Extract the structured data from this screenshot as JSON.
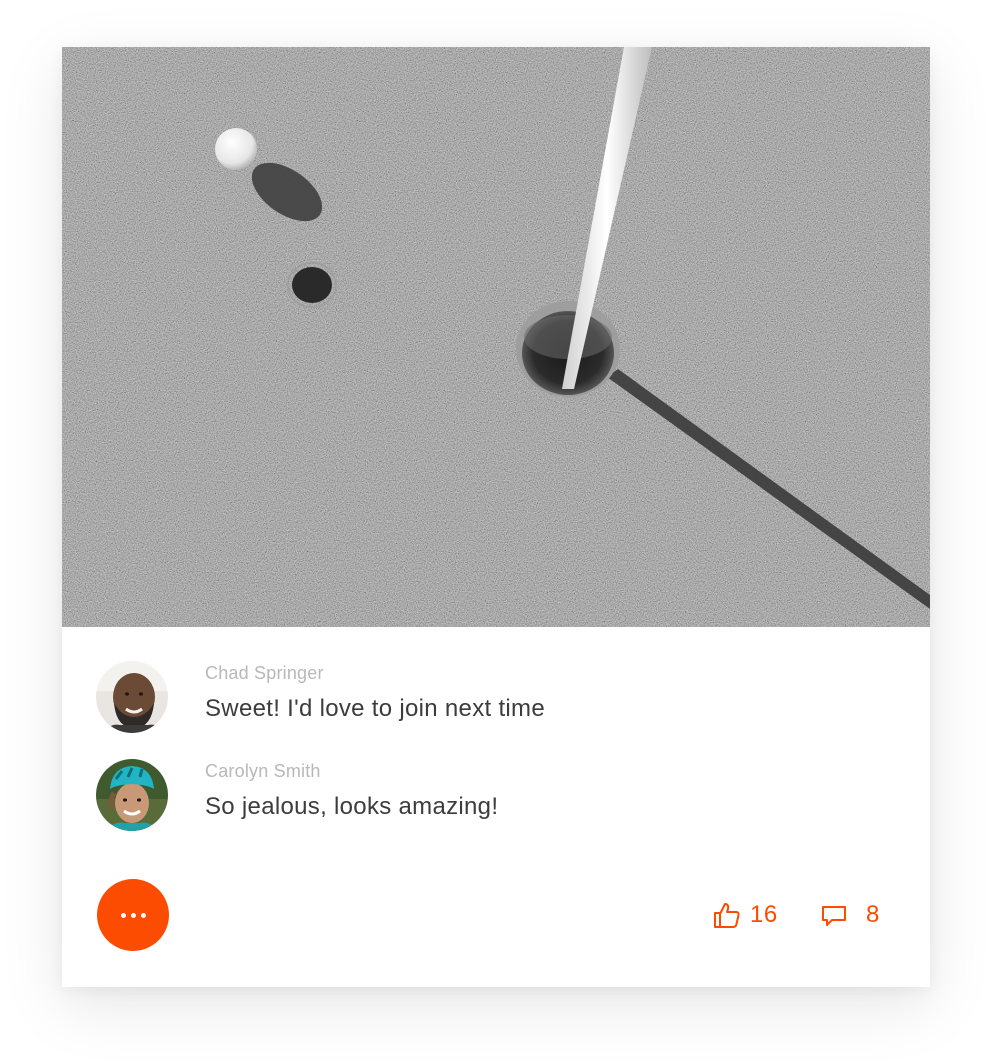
{
  "theme": {
    "accent": "#fc4c02"
  },
  "post": {
    "photo_alt": "Golf ball rolling past the cup on a putting green"
  },
  "comments": [
    {
      "author": "Chad Springer",
      "text": "Sweet! I'd love to join next time"
    },
    {
      "author": "Carolyn Smith",
      "text": "So jealous, looks amazing!"
    }
  ],
  "actions": {
    "more_icon": "ellipsis-icon",
    "like_icon": "thumbs-up-icon",
    "like_count": "16",
    "comment_icon": "speech-bubble-icon",
    "comment_count": "8"
  }
}
